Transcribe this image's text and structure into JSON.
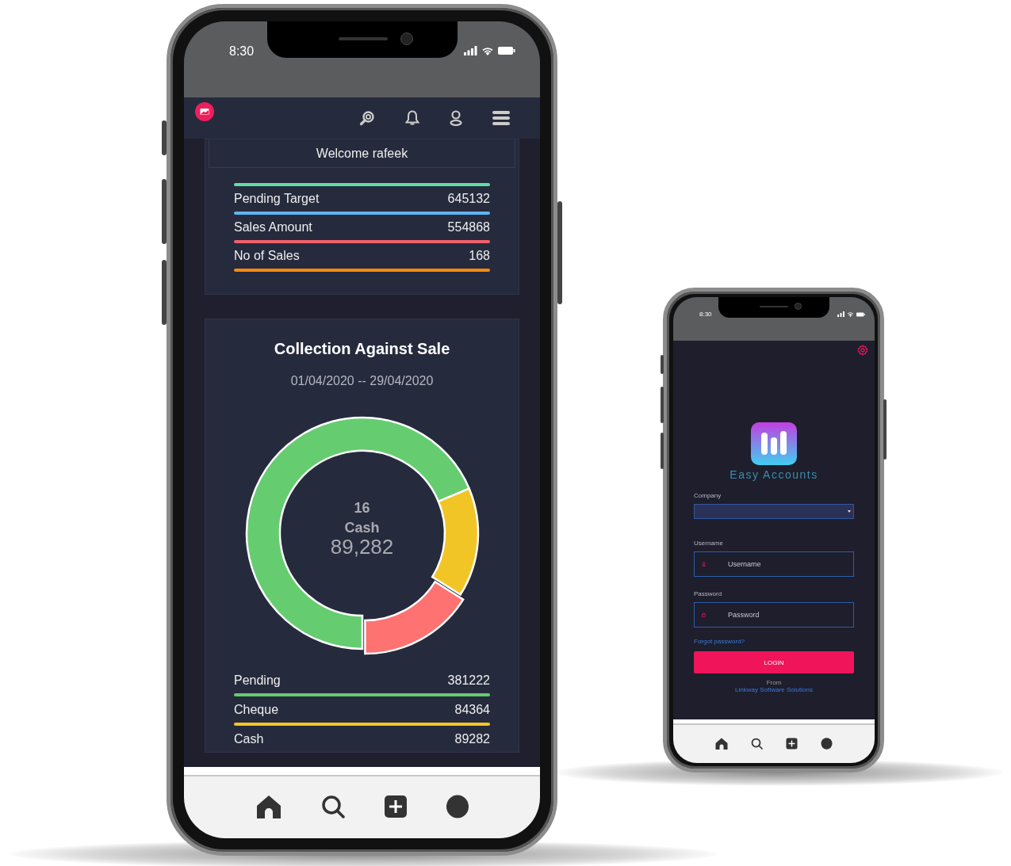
{
  "dashboard_phone": {
    "status_bar": {
      "time": "8:30"
    },
    "welcome": "Welcome rafeek",
    "target_card": {
      "scrolled_row": {
        "color": "#5fe0a0"
      },
      "rows": [
        {
          "label": "Pending Target",
          "value": "645132",
          "color": "#5fb4f2"
        },
        {
          "label": "Sales Amount",
          "value": "554868",
          "color": "#f0606a"
        },
        {
          "label": "No of Sales",
          "value": "168",
          "color": "#f58a0c"
        }
      ]
    },
    "collection_card": {
      "title": "Collection Against Sale",
      "date_range": "01/04/2020 -- 29/04/2020",
      "center": {
        "count": "16",
        "label": "Cash",
        "value": "89,282"
      },
      "chart_data": {
        "type": "donut",
        "values": [
          68.7,
          15.2,
          16.1
        ],
        "colors": [
          "#66cc70",
          "#f2c526",
          "#ff7272"
        ]
      },
      "legend": [
        {
          "label": "Pending",
          "value": "381222",
          "color": "#66cc70",
          "selected": false
        },
        {
          "label": "Cheque",
          "value": "84364",
          "color": "#f2c526",
          "selected": false
        },
        {
          "label": "Cash",
          "value": "89282",
          "selected": true
        }
      ]
    }
  },
  "login_phone": {
    "status_bar": {
      "time": "8:30"
    },
    "app_name": "Easy Accounts",
    "company": {
      "label": "Company"
    },
    "username": {
      "label": "Username",
      "placeholder": "Username"
    },
    "password": {
      "label": "Password",
      "placeholder": "Password"
    },
    "forgot_link": "Forgot password?",
    "login_button": "LOGIN",
    "footer": {
      "from": "From",
      "company": "Linkway Software Solutions"
    }
  }
}
